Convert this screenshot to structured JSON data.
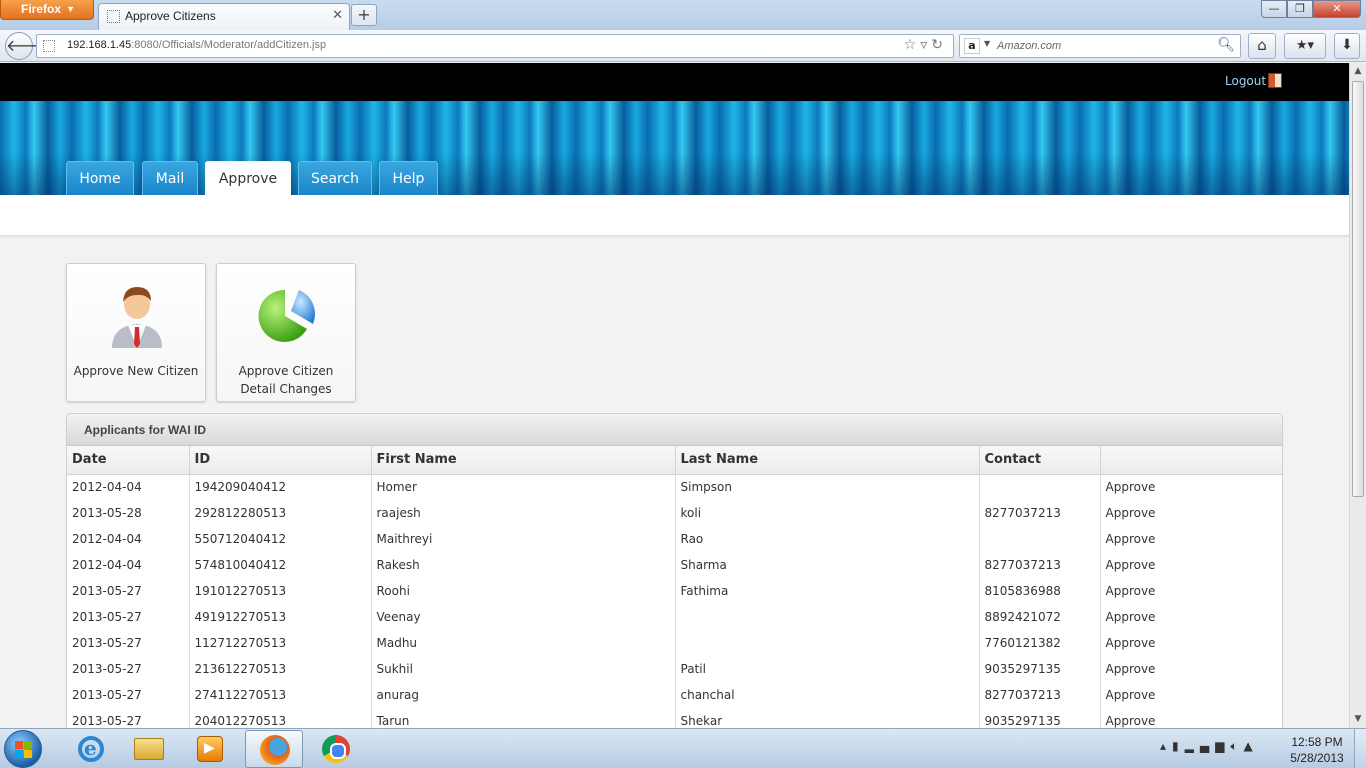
{
  "browser": {
    "menu_label": "Firefox",
    "tab_title": "Approve Citizens",
    "url_host": "192.168.1.45",
    "url_rest": ":8080/Officials/Moderator/addCitizen.jsp",
    "search_placeholder": "Amazon.com"
  },
  "header": {
    "logout_label": "Logout",
    "nav": [
      {
        "label": "Home"
      },
      {
        "label": "Mail"
      },
      {
        "label": "Approve",
        "active": true
      },
      {
        "label": "Search"
      },
      {
        "label": "Help"
      }
    ]
  },
  "actions": [
    {
      "label": "Approve New Citizen",
      "icon": "person-icon"
    },
    {
      "label": "Approve Citizen Detail Changes",
      "icon": "pie-chart-icon"
    }
  ],
  "panel": {
    "title": "Applicants for WAI ID",
    "columns": [
      "Date",
      "ID",
      "First Name",
      "Last Name",
      "Contact",
      ""
    ],
    "rows": [
      {
        "date": "2012-04-04",
        "id": "194209040412",
        "first": "Homer",
        "last": "Simpson",
        "contact": "",
        "action": "Approve"
      },
      {
        "date": "2013-05-28",
        "id": "292812280513",
        "first": "raajesh",
        "last": "koli",
        "contact": "8277037213",
        "action": "Approve"
      },
      {
        "date": "2012-04-04",
        "id": "550712040412",
        "first": "Maithreyi",
        "last": "Rao",
        "contact": "",
        "action": "Approve"
      },
      {
        "date": "2012-04-04",
        "id": "574810040412",
        "first": "Rakesh",
        "last": "Sharma",
        "contact": "8277037213",
        "action": "Approve"
      },
      {
        "date": "2013-05-27",
        "id": "191012270513",
        "first": "Roohi",
        "last": "Fathima",
        "contact": "8105836988",
        "action": "Approve"
      },
      {
        "date": "2013-05-27",
        "id": "491912270513",
        "first": "Veenay",
        "last": "",
        "contact": "8892421072",
        "action": "Approve"
      },
      {
        "date": "2013-05-27",
        "id": "112712270513",
        "first": "Madhu",
        "last": "",
        "contact": "7760121382",
        "action": "Approve"
      },
      {
        "date": "2013-05-27",
        "id": "213612270513",
        "first": "Sukhil",
        "last": "Patil",
        "contact": "9035297135",
        "action": "Approve"
      },
      {
        "date": "2013-05-27",
        "id": "274112270513",
        "first": "anurag",
        "last": "chanchal",
        "contact": "8277037213",
        "action": "Approve"
      },
      {
        "date": "2013-05-27",
        "id": "204012270513",
        "first": "Tarun",
        "last": "Shekar",
        "contact": "9035297135",
        "action": "Approve"
      }
    ]
  },
  "taskbar": {
    "time": "12:58 PM",
    "date": "5/28/2013"
  },
  "colors": {
    "accent": "#1a86c9",
    "link": "#1a6fbf",
    "logout": "#9fd4f2"
  }
}
